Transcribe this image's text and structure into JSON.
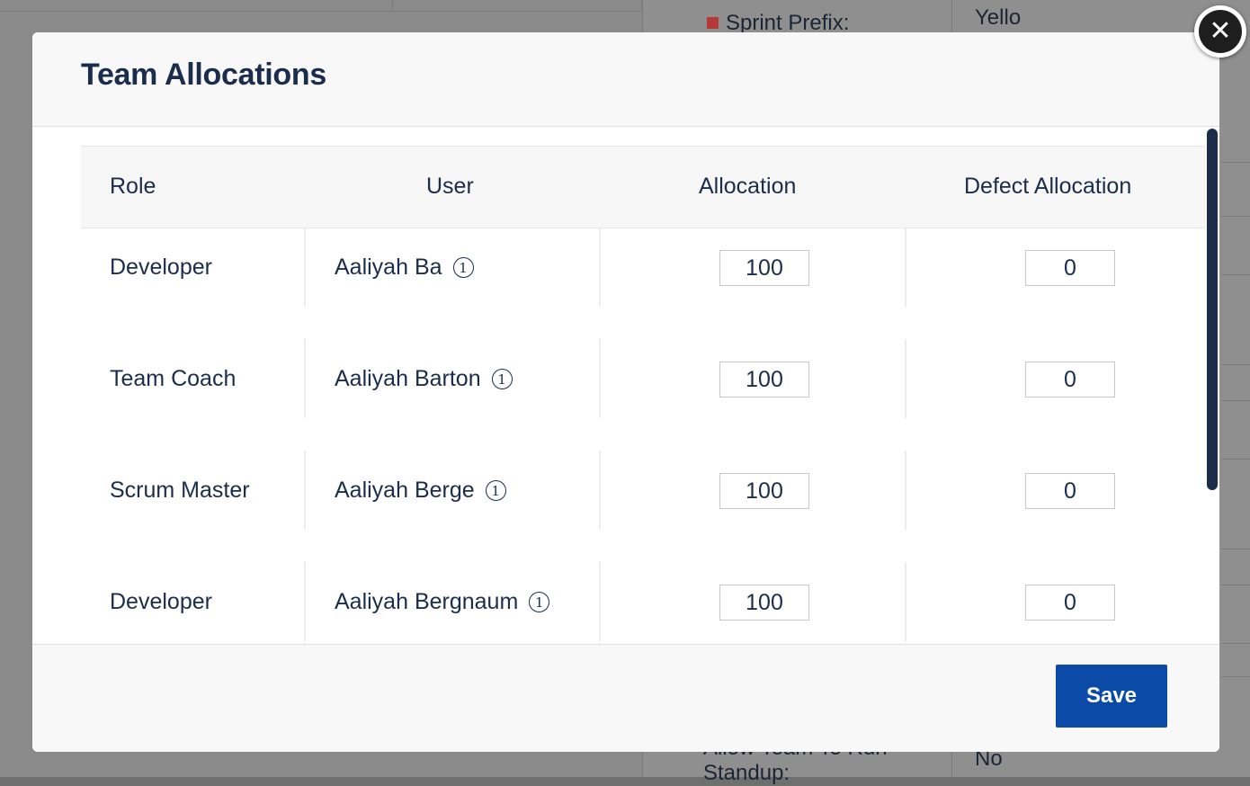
{
  "background": {
    "sprint_prefix_label": "Sprint Prefix:",
    "sprint_prefix_value": "Yello",
    "standup_label_line1": "Allow Team To Run",
    "standup_label_line2": "Standup:",
    "standup_value": "No"
  },
  "modal": {
    "title": "Team Allocations",
    "close_icon": "close-icon",
    "save_label": "Save"
  },
  "table": {
    "headers": {
      "role": "Role",
      "user": "User",
      "allocation": "Allocation",
      "defect_allocation": "Defect Allocation"
    },
    "rows": [
      {
        "role": "Developer",
        "user": "Aaliyah Ba",
        "info_glyph": "1",
        "allocation": "100",
        "defect_allocation": "0"
      },
      {
        "role": "Team Coach",
        "user": "Aaliyah Barton",
        "info_glyph": "1",
        "allocation": "100",
        "defect_allocation": "0"
      },
      {
        "role": "Scrum Master",
        "user": "Aaliyah Berge",
        "info_glyph": "1",
        "allocation": "100",
        "defect_allocation": "0"
      },
      {
        "role": "Developer",
        "user": "Aaliyah Bergnaum",
        "info_glyph": "1",
        "allocation": "100",
        "defect_allocation": "0"
      }
    ]
  },
  "colors": {
    "primary": "#0b4aa6",
    "text": "#1b2d4a",
    "scroll_thumb": "#1b2d4a"
  }
}
